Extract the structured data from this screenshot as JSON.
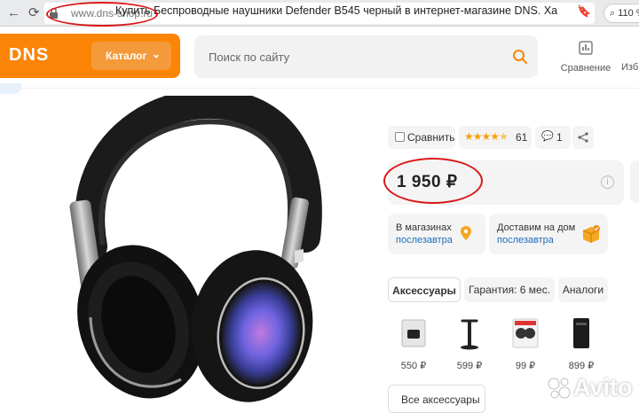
{
  "browser": {
    "url": "www.dns-shop.ru",
    "tab_title": "Купить Беспроводные наушники Defender B545 черный в интернет-магазине DNS. Ха",
    "zoom": "110 %"
  },
  "header": {
    "logo": "DNS",
    "catalog_label": "Каталог",
    "search_placeholder": "Поиск по сайту",
    "compare_label": "Сравнение",
    "favorites_label": "Изб"
  },
  "product": {
    "compare_label": "Сравнить",
    "rating": 4.5,
    "reviews_count": "61",
    "comments_count": "1",
    "price": "1 950 ₽"
  },
  "availability": {
    "stores": {
      "label": "В магазинах",
      "date": "послезавтра"
    },
    "delivery": {
      "label": "Доставим на дом",
      "date": "послезавтра"
    }
  },
  "tabs": [
    {
      "label": "Аксессуары"
    },
    {
      "label": "Гарантия: 6 мес."
    },
    {
      "label": "Аналоги"
    }
  ],
  "accessories": [
    {
      "price": "550 ₽"
    },
    {
      "price": "599 ₽"
    },
    {
      "price": "99 ₽"
    },
    {
      "price": "899 ₽"
    }
  ],
  "all_accessories_label": "Все аксессуары",
  "watermark": "Avito",
  "colors": {
    "brand_orange": "#fc8507",
    "link_blue": "#1e6dbc",
    "annotation_red": "#d81a1a",
    "star": "#f6a209"
  }
}
